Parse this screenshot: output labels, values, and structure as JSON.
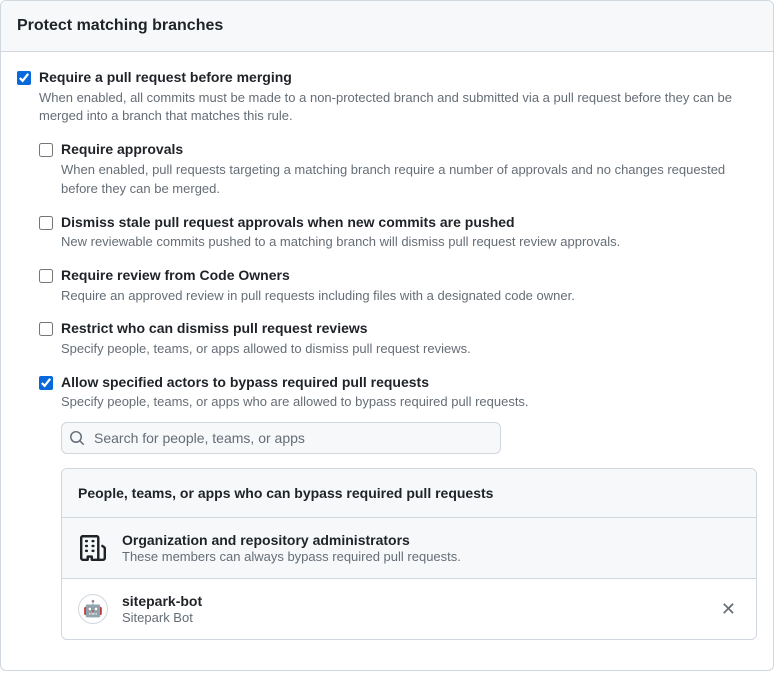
{
  "header": "Protect matching branches",
  "requirePR": {
    "title": "Require a pull request before merging",
    "desc": "When enabled, all commits must be made to a non-protected branch and submitted via a pull request before they can be merged into a branch that matches this rule."
  },
  "sub": {
    "approvals": {
      "title": "Require approvals",
      "desc": "When enabled, pull requests targeting a matching branch require a number of approvals and no changes requested before they can be merged."
    },
    "dismiss": {
      "title": "Dismiss stale pull request approvals when new commits are pushed",
      "desc": "New reviewable commits pushed to a matching branch will dismiss pull request review approvals."
    },
    "codeowners": {
      "title": "Require review from Code Owners",
      "desc": "Require an approved review in pull requests including files with a designated code owner."
    },
    "restrict": {
      "title": "Restrict who can dismiss pull request reviews",
      "desc": "Specify people, teams, or apps allowed to dismiss pull request reviews."
    },
    "bypass": {
      "title": "Allow specified actors to bypass required pull requests",
      "desc": "Specify people, teams, or apps who are allowed to bypass required pull requests."
    }
  },
  "search": {
    "placeholder": "Search for people, teams, or apps"
  },
  "bypassBox": {
    "header": "People, teams, or apps who can bypass required pull requests",
    "admins": {
      "title": "Organization and repository administrators",
      "desc": "These members can always bypass required pull requests."
    },
    "actor": {
      "name": "sitepark-bot",
      "sub": "Sitepark Bot"
    }
  }
}
